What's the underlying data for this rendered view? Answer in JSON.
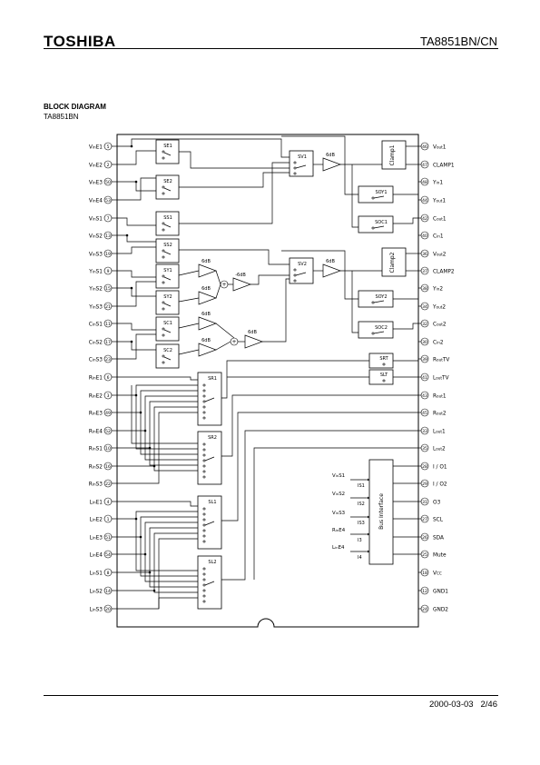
{
  "header": {
    "logo": "TOSHIBA",
    "part_number": "TA8851BN/CN"
  },
  "section": {
    "title": "BLOCK DIAGRAM",
    "subtitle": "TA8851BN"
  },
  "footer": {
    "date": "2000-03-03",
    "page": "2/46"
  },
  "diagram": {
    "left_pins": [
      {
        "num": "5",
        "pre": "V",
        "sub": "in",
        "post": "E1"
      },
      {
        "num": "2",
        "pre": "V",
        "sub": "in",
        "post": "E2"
      },
      {
        "num": "50",
        "pre": "V",
        "sub": "in",
        "post": "E3"
      },
      {
        "num": "53",
        "pre": "V",
        "sub": "in",
        "post": "E4"
      },
      {
        "num": "7",
        "pre": "V",
        "sub": "in",
        "post": "S1"
      },
      {
        "num": "13",
        "pre": "V",
        "sub": "in",
        "post": "S2"
      },
      {
        "num": "19",
        "pre": "V",
        "sub": "in",
        "post": "S3"
      },
      {
        "num": "9",
        "pre": "Y",
        "sub": "in",
        "post": "S1"
      },
      {
        "num": "15",
        "pre": "Y",
        "sub": "in",
        "post": "S2"
      },
      {
        "num": "21",
        "pre": "Y",
        "sub": "in",
        "post": "S3"
      },
      {
        "num": "11",
        "pre": "C",
        "sub": "in",
        "post": "S1"
      },
      {
        "num": "17",
        "pre": "C",
        "sub": "in",
        "post": "S2"
      },
      {
        "num": "23",
        "pre": "C",
        "sub": "in",
        "post": "S3"
      },
      {
        "num": "6",
        "pre": "R",
        "sub": "in",
        "post": "E1"
      },
      {
        "num": "3",
        "pre": "R",
        "sub": "in",
        "post": "E2"
      },
      {
        "num": "49",
        "pre": "R",
        "sub": "in",
        "post": "E3"
      },
      {
        "num": "52",
        "pre": "R",
        "sub": "in",
        "post": "E4"
      },
      {
        "num": "10",
        "pre": "R",
        "sub": "in",
        "post": "S1"
      },
      {
        "num": "16",
        "pre": "R",
        "sub": "in",
        "post": "S2"
      },
      {
        "num": "22",
        "pre": "R",
        "sub": "in",
        "post": "S3"
      },
      {
        "num": "4",
        "pre": "L",
        "sub": "in",
        "post": "E1"
      },
      {
        "num": "1",
        "pre": "L",
        "sub": "in",
        "post": "E2"
      },
      {
        "num": "51",
        "pre": "L",
        "sub": "in",
        "post": "E3"
      },
      {
        "num": "54",
        "pre": "L",
        "sub": "in",
        "post": "E4"
      },
      {
        "num": "8",
        "pre": "L",
        "sub": "in",
        "post": "S1"
      },
      {
        "num": "14",
        "pre": "L",
        "sub": "in",
        "post": "S2"
      },
      {
        "num": "20",
        "pre": "L",
        "sub": "in",
        "post": "S3"
      }
    ],
    "right_pins": [
      {
        "num": "46",
        "pre": "V",
        "sub": "out",
        "post": "1"
      },
      {
        "num": "47",
        "pre": "CLAMP1",
        "sub": "",
        "post": ""
      },
      {
        "num": "48",
        "pre": "Y",
        "sub": "in",
        "post": "1"
      },
      {
        "num": "44",
        "pre": "Y",
        "sub": "out",
        "post": "1"
      },
      {
        "num": "42",
        "pre": "C",
        "sub": "out",
        "post": "1"
      },
      {
        "num": "40",
        "pre": "C",
        "sub": "in",
        "post": "1"
      },
      {
        "num": "36",
        "pre": "V",
        "sub": "out",
        "post": "2"
      },
      {
        "num": "37",
        "pre": "CLAMP2",
        "sub": "",
        "post": ""
      },
      {
        "num": "38",
        "pre": "Y",
        "sub": "in",
        "post": "2"
      },
      {
        "num": "34",
        "pre": "Y",
        "sub": "out",
        "post": "2"
      },
      {
        "num": "32",
        "pre": "C",
        "sub": "out",
        "post": "2"
      },
      {
        "num": "30",
        "pre": "C",
        "sub": "in",
        "post": "2"
      },
      {
        "num": "39",
        "pre": "R",
        "sub": "out",
        "post": "TV"
      },
      {
        "num": "41",
        "pre": "L",
        "sub": "out",
        "post": "TV"
      },
      {
        "num": "43",
        "pre": "R",
        "sub": "out",
        "post": "1"
      },
      {
        "num": "45",
        "pre": "R",
        "sub": "out",
        "post": "2"
      },
      {
        "num": "33",
        "pre": "L",
        "sub": "out",
        "post": "1"
      },
      {
        "num": "35",
        "pre": "L",
        "sub": "out",
        "post": "2"
      },
      {
        "num": "28",
        "pre": "I / O1",
        "sub": "",
        "post": ""
      },
      {
        "num": "29",
        "pre": "I / O2",
        "sub": "",
        "post": ""
      },
      {
        "num": "31",
        "pre": "O3",
        "sub": "",
        "post": ""
      },
      {
        "num": "27",
        "pre": "SCL",
        "sub": "",
        "post": ""
      },
      {
        "num": "26",
        "pre": "SDA",
        "sub": "",
        "post": ""
      },
      {
        "num": "25",
        "pre": "Mute",
        "sub": "",
        "post": ""
      },
      {
        "num": "18",
        "pre": "V",
        "sub": "CC",
        "post": ""
      },
      {
        "num": "12",
        "pre": "GND1",
        "sub": "",
        "post": ""
      },
      {
        "num": "24",
        "pre": "GND2",
        "sub": "",
        "post": ""
      }
    ],
    "switch_blocks": [
      "SE1",
      "SE2",
      "SS1",
      "SS2",
      "SY1",
      "SY2",
      "SC1",
      "SC2",
      "SV1",
      "SV2",
      "SOY1",
      "SOC1",
      "SOY2",
      "SOC2",
      "SRT",
      "SLT",
      "SR1",
      "SR2",
      "SL1",
      "SL2"
    ],
    "clamp_blocks": [
      "Clamp1",
      "Clamp2"
    ],
    "gain_labels": [
      "6dB",
      "6dB",
      "6dB",
      "6dB",
      "6dB",
      "6dB",
      "-6dB",
      "6dB"
    ],
    "bus": {
      "title": "Bus Interface",
      "inputs": [
        {
          "pre": "V",
          "sub": "in",
          "post": "S1",
          "label": "IS1"
        },
        {
          "pre": "V",
          "sub": "in",
          "post": "S2",
          "label": "IS2"
        },
        {
          "pre": "V",
          "sub": "in",
          "post": "S3",
          "label": "IS3"
        },
        {
          "pre": "R",
          "sub": "in",
          "post": "E4",
          "label": "I3"
        },
        {
          "pre": "L",
          "sub": "in",
          "post": "E4",
          "label": "I4"
        }
      ]
    },
    "adder_symbol": "+"
  }
}
